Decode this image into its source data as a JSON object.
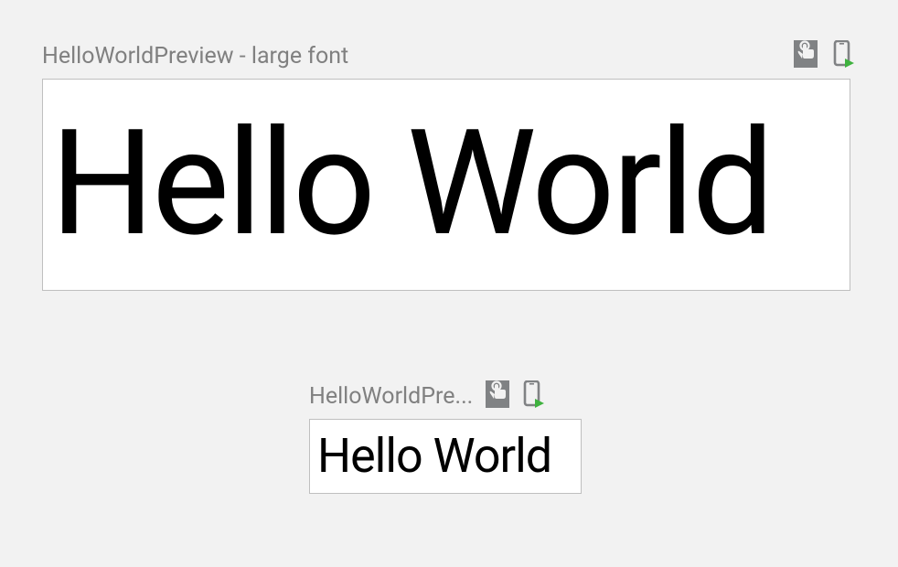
{
  "previews": {
    "large": {
      "title": "HelloWorldPreview - large font",
      "content": "Hello World"
    },
    "small": {
      "title": "HelloWorldPre...",
      "content": "Hello World"
    }
  },
  "colors": {
    "iconBg": "#808284",
    "iconAccent": "#3fb23f"
  }
}
